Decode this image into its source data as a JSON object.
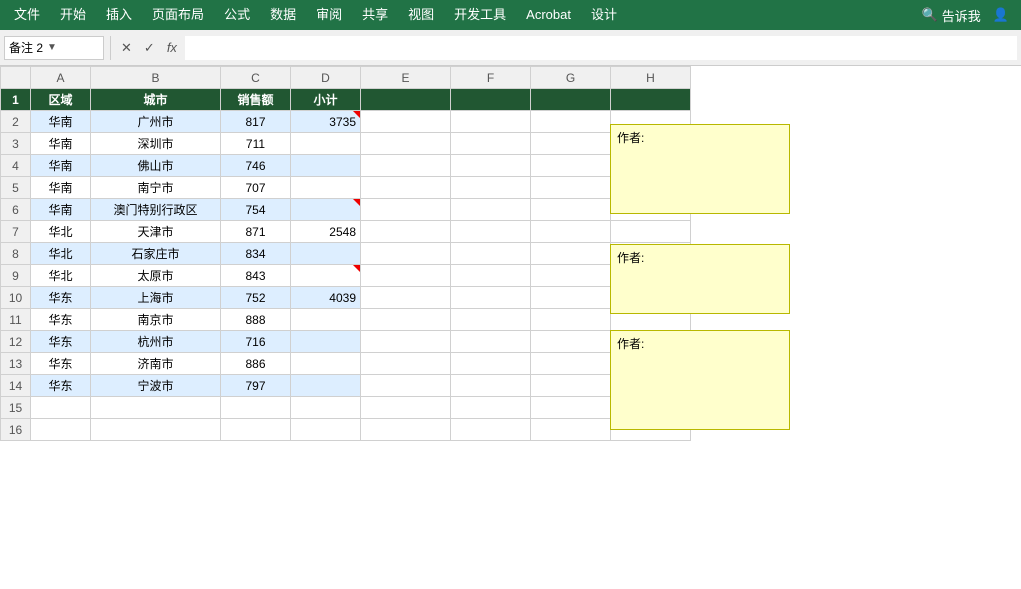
{
  "menubar": {
    "items": [
      "文件",
      "开始",
      "插入",
      "页面布局",
      "公式",
      "数据",
      "审阅",
      "共享",
      "视图",
      "开发工具",
      "Acrobat",
      "设计"
    ],
    "search_placeholder": "告诉我",
    "search_icon": "🔍",
    "user_icon": "👤"
  },
  "formulabar": {
    "namebox_value": "备注 2",
    "cancel_label": "✕",
    "confirm_label": "✓",
    "fx_label": "fx",
    "formula_value": ""
  },
  "spreadsheet": {
    "col_headers": [
      "",
      "A",
      "B",
      "C",
      "D",
      "E",
      "F",
      "G",
      "H"
    ],
    "rows": [
      {
        "num": "",
        "a": "区域",
        "b": "城市",
        "c": "销售额",
        "d": "小计",
        "is_header": true
      },
      {
        "num": "2",
        "a": "华南",
        "b": "广州市",
        "c": "817",
        "d": "3735",
        "blue": true,
        "comment_d": true
      },
      {
        "num": "3",
        "a": "华南",
        "b": "深圳市",
        "c": "711",
        "d": "",
        "blue": false
      },
      {
        "num": "4",
        "a": "华南",
        "b": "佛山市",
        "c": "746",
        "d": "",
        "blue": true
      },
      {
        "num": "5",
        "a": "华南",
        "b": "南宁市",
        "c": "707",
        "d": "",
        "blue": false
      },
      {
        "num": "6",
        "a": "华南",
        "b": "澳门特别行政区",
        "c": "754",
        "d": "",
        "blue": true,
        "comment_d2": true
      },
      {
        "num": "7",
        "a": "华北",
        "b": "天津市",
        "c": "871",
        "d": "2548",
        "blue": false
      },
      {
        "num": "8",
        "a": "华北",
        "b": "石家庄市",
        "c": "834",
        "d": "",
        "blue": true
      },
      {
        "num": "9",
        "a": "华北",
        "b": "太原市",
        "c": "843",
        "d": "",
        "blue": false,
        "comment_d3": true
      },
      {
        "num": "10",
        "a": "华东",
        "b": "上海市",
        "c": "752",
        "d": "4039",
        "blue": true
      },
      {
        "num": "11",
        "a": "华东",
        "b": "南京市",
        "c": "888",
        "d": "",
        "blue": false
      },
      {
        "num": "12",
        "a": "华东",
        "b": "杭州市",
        "c": "716",
        "d": "",
        "blue": true
      },
      {
        "num": "13",
        "a": "华东",
        "b": "济南市",
        "c": "886",
        "d": "",
        "blue": false
      },
      {
        "num": "14",
        "a": "华东",
        "b": "宁波市",
        "c": "797",
        "d": "",
        "blue": true
      },
      {
        "num": "15",
        "a": "",
        "b": "",
        "c": "",
        "d": "",
        "blue": false
      },
      {
        "num": "16",
        "a": "",
        "b": "",
        "c": "",
        "d": "",
        "blue": false
      }
    ],
    "comments": [
      {
        "id": "comment1",
        "author_label": "作者:",
        "content": ""
      },
      {
        "id": "comment2",
        "author_label": "作者:",
        "content": ""
      },
      {
        "id": "comment3",
        "author_label": "作者:",
        "content": ""
      }
    ]
  }
}
